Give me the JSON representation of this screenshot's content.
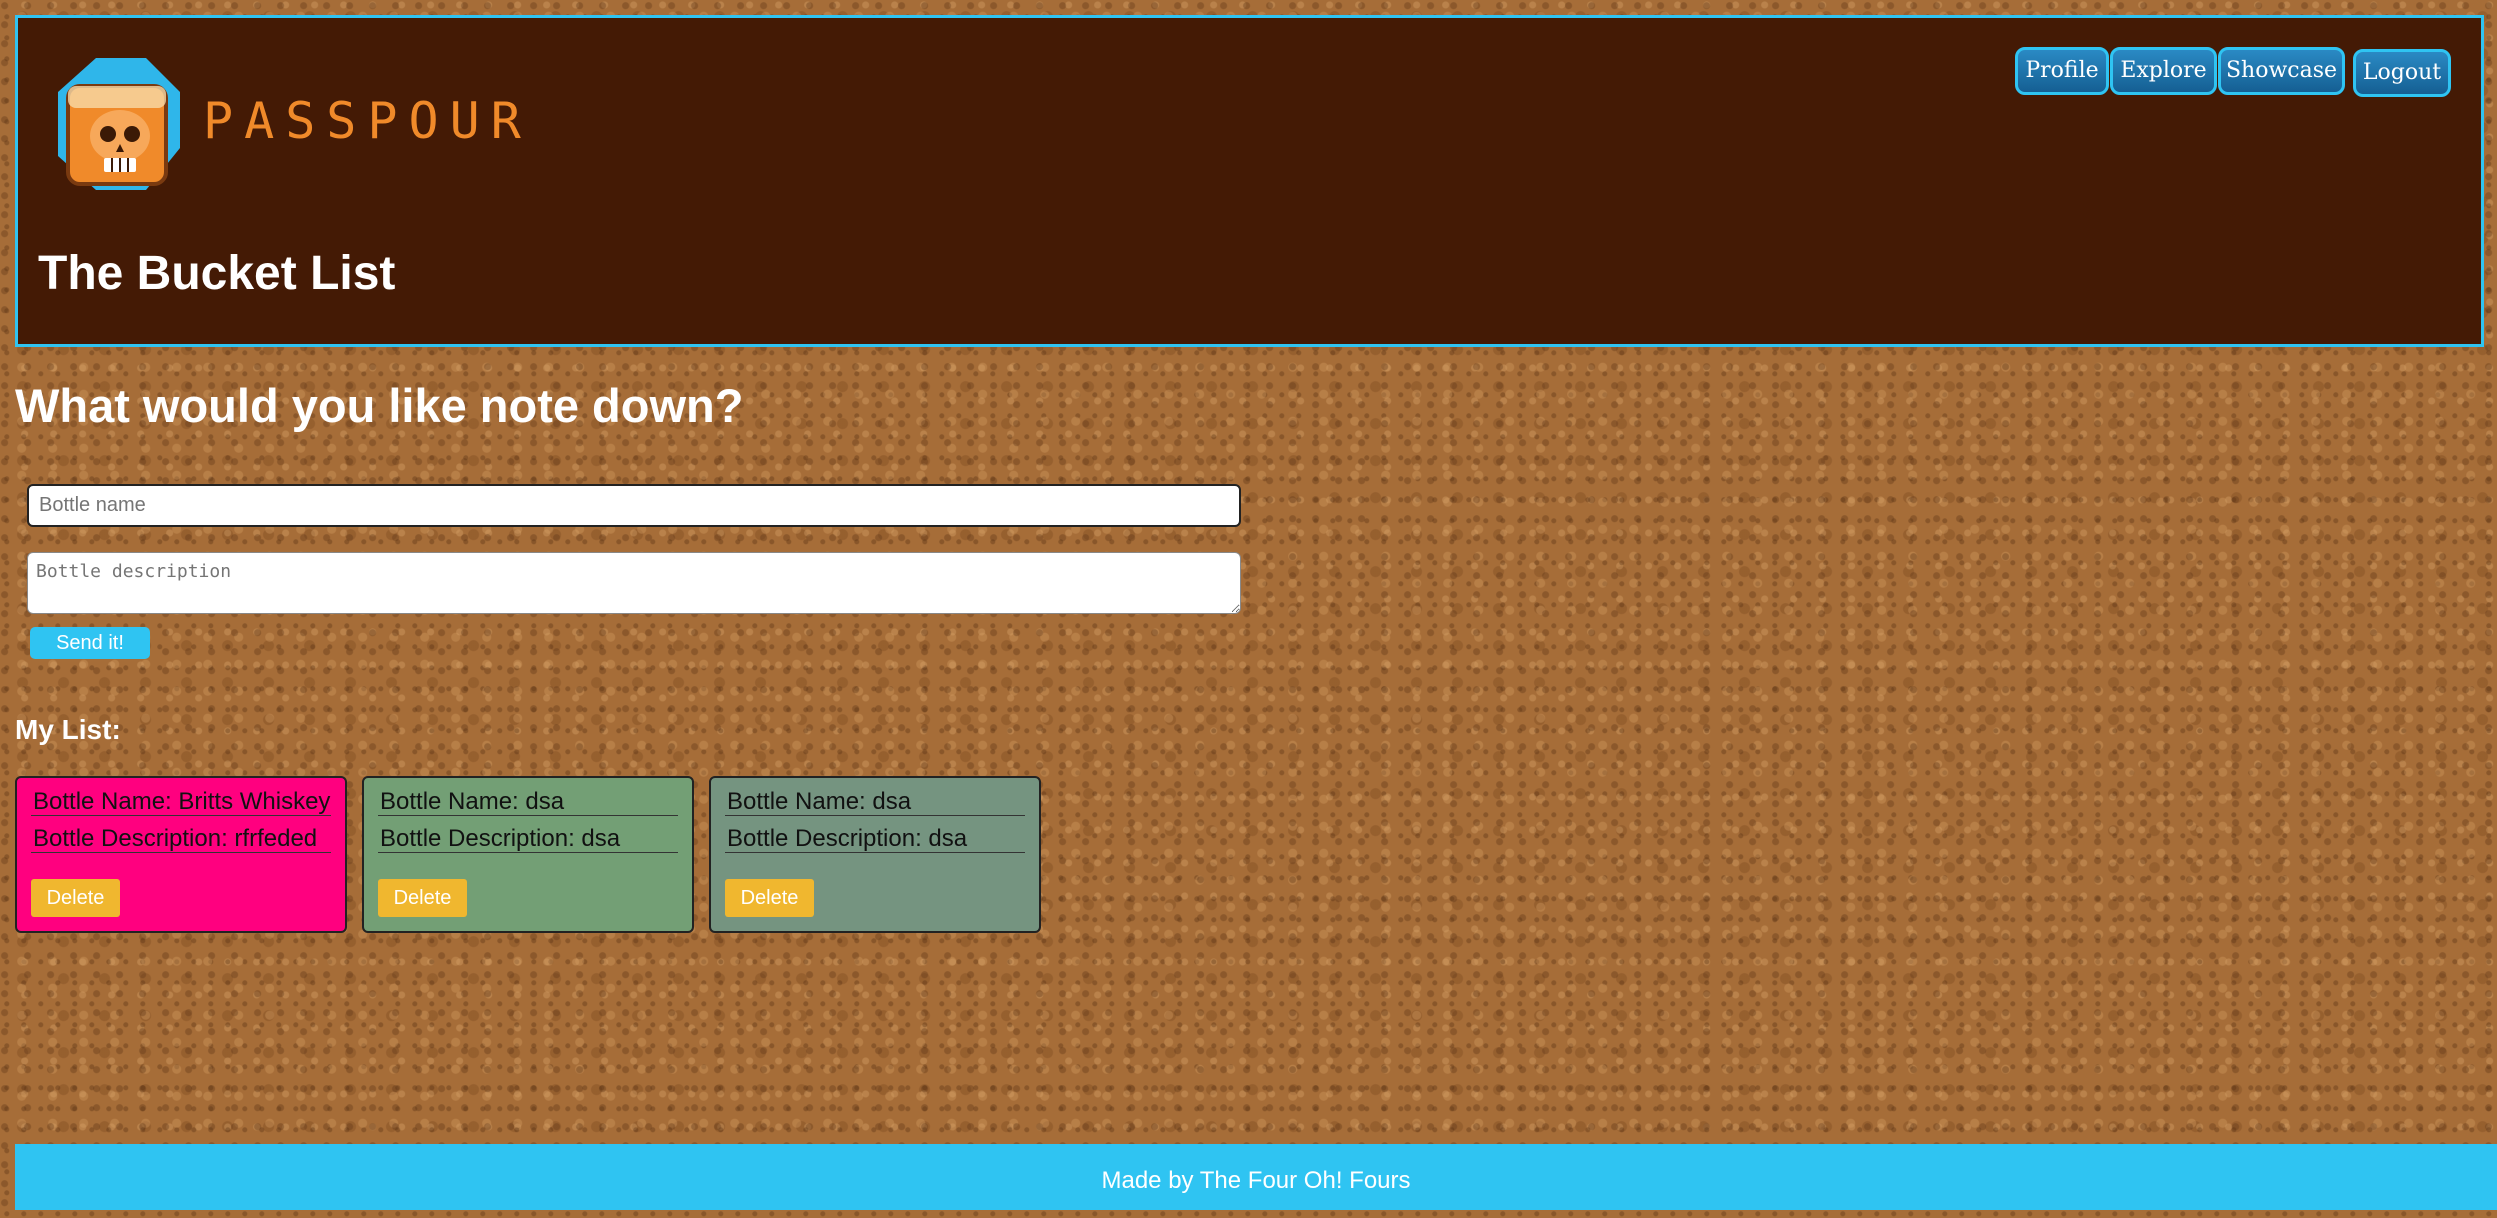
{
  "brand": {
    "name": "PASSPOUR",
    "logo_icon": "whiskey-glass-skull-icon",
    "colors": {
      "header_bg": "#441a05",
      "accent": "#2fc4f2",
      "logo_text": "#f08a2a"
    }
  },
  "header": {
    "title": "The Bucket List",
    "nav": [
      {
        "label": "Profile"
      },
      {
        "label": "Explore"
      },
      {
        "label": "Showcase"
      },
      {
        "label": "Logout"
      }
    ]
  },
  "form": {
    "heading": "What would you like note down?",
    "name_placeholder": "Bottle name",
    "name_value": "",
    "description_placeholder": "Bottle description",
    "description_value": "",
    "submit_label": "Send it!"
  },
  "list": {
    "heading": "My List:",
    "items": [
      {
        "name": "Bottle Name: Britts Whiskey",
        "description": "Bottle Description: rfrfeded",
        "delete_label": "Delete",
        "color": "#ff007f"
      },
      {
        "name": "Bottle Name: dsa",
        "description": "Bottle Description: dsa",
        "delete_label": "Delete",
        "color": "#739f75"
      },
      {
        "name": "Bottle Name: dsa",
        "description": "Bottle Description: dsa",
        "delete_label": "Delete",
        "color": "#759480"
      }
    ]
  },
  "footer": {
    "text": "Made by The Four Oh! Fours"
  }
}
